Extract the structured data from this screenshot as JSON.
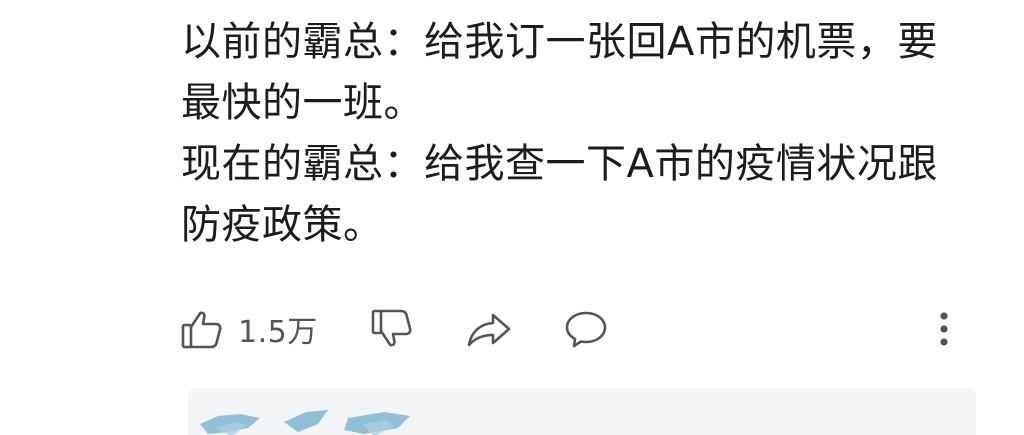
{
  "comment": {
    "lines": [
      "以前的霸总：给我订一张回A市的机票，要",
      "最快的一班。",
      "现在的霸总：给我查一下A市的疫情状况跟",
      "防疫政策。"
    ]
  },
  "actions": {
    "like_count": "1.5万",
    "like_icon": "thumbs-up-icon",
    "dislike_icon": "thumbs-down-icon",
    "share_icon": "share-arrow-icon",
    "reply_icon": "speech-bubble-icon",
    "more_icon": "vertical-ellipsis-icon",
    "icon_color": "#555555"
  },
  "colors": {
    "text": "#1c1c1c",
    "background": "#ffffff",
    "preview_bg": "#f3f4f5",
    "preview_accent": "#7fb6d4"
  }
}
